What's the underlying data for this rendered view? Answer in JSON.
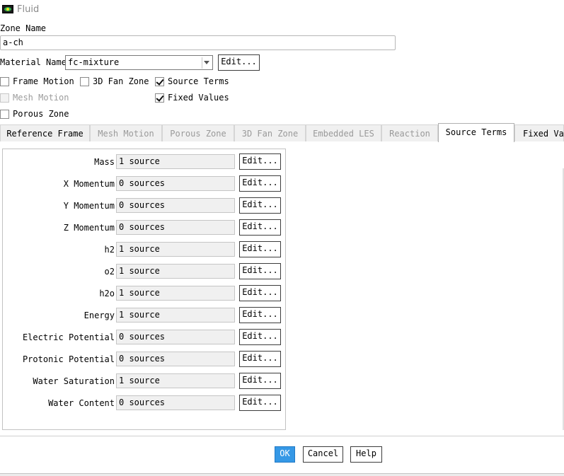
{
  "window": {
    "title": "Fluid",
    "icon": "fluid-eye-icon"
  },
  "zone_name": {
    "label": "Zone Name",
    "value": "a-ch"
  },
  "material": {
    "label": "Material Name",
    "value": "fc-mixture",
    "edit_label": "Edit..."
  },
  "options": [
    {
      "label": "Frame Motion",
      "checked": false,
      "disabled": false
    },
    {
      "label": "3D Fan Zone",
      "checked": false,
      "disabled": false
    },
    {
      "label": "Source Terms",
      "checked": true,
      "disabled": false
    },
    {
      "label": "Mesh Motion",
      "checked": false,
      "disabled": true
    },
    {
      "label": "Fixed Values",
      "checked": true,
      "disabled": false
    },
    {
      "label": "Porous Zone",
      "checked": false,
      "disabled": false
    }
  ],
  "tabs": [
    {
      "label": "Reference Frame",
      "state": "enabled"
    },
    {
      "label": "Mesh Motion",
      "state": "disabled"
    },
    {
      "label": "Porous Zone",
      "state": "disabled"
    },
    {
      "label": "3D Fan Zone",
      "state": "disabled"
    },
    {
      "label": "Embedded LES",
      "state": "disabled"
    },
    {
      "label": "Reaction",
      "state": "disabled"
    },
    {
      "label": "Source Terms",
      "state": "active"
    },
    {
      "label": "Fixed Val",
      "state": "enabled"
    }
  ],
  "sources": [
    {
      "label": "Mass",
      "value": "1 source",
      "edit_label": "Edit..."
    },
    {
      "label": "X Momentum",
      "value": "0 sources",
      "edit_label": "Edit..."
    },
    {
      "label": "Y Momentum",
      "value": "0 sources",
      "edit_label": "Edit..."
    },
    {
      "label": "Z Momentum",
      "value": "0 sources",
      "edit_label": "Edit..."
    },
    {
      "label": "h2",
      "value": "1 source",
      "edit_label": "Edit..."
    },
    {
      "label": "o2",
      "value": "1 source",
      "edit_label": "Edit..."
    },
    {
      "label": "h2o",
      "value": "1 source",
      "edit_label": "Edit..."
    },
    {
      "label": "Energy",
      "value": "1 source",
      "edit_label": "Edit..."
    },
    {
      "label": "Electric Potential",
      "value": "0 sources",
      "edit_label": "Edit..."
    },
    {
      "label": "Protonic Potential",
      "value": "0 sources",
      "edit_label": "Edit..."
    },
    {
      "label": "Water Saturation",
      "value": "1 source",
      "edit_label": "Edit..."
    },
    {
      "label": "Water Content",
      "value": "0 sources",
      "edit_label": "Edit..."
    }
  ],
  "footer": {
    "ok": "OK",
    "cancel": "Cancel",
    "help": "Help"
  },
  "colors": {
    "accent": "#3598e6"
  }
}
